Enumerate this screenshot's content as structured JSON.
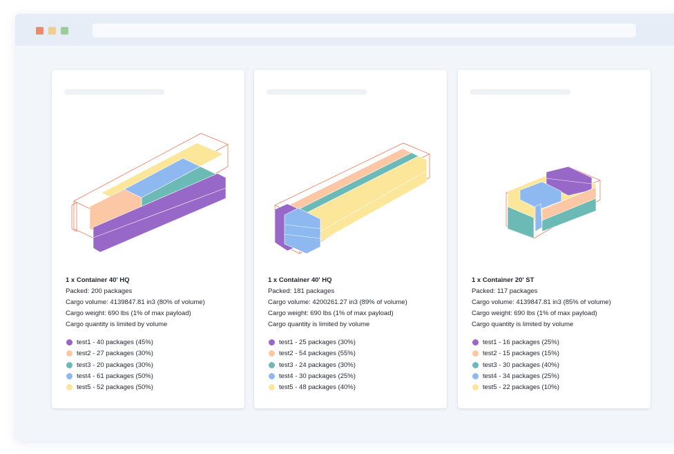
{
  "colors": {
    "test1": "#9768c7",
    "test2": "#fbc7a5",
    "test3": "#6bbab5",
    "test4": "#8eb8f0",
    "test5": "#fbe69a",
    "outline": "#e97a5c"
  },
  "window_dots": [
    "#ea8c6a",
    "#f0cf8e",
    "#9ccc9a"
  ],
  "cards": [
    {
      "title": "1 x Container 40' HQ",
      "packed": "Packed: 200 packages",
      "volume": "Cargo volume: 4139847.81 in3 (80% of volume)",
      "weight": "Cargo weight: 690 lbs (1% of max payload)",
      "limit": "Cargo quantity is limited by volume",
      "legend": [
        {
          "label": "test1 - 40 packages  (45%)",
          "color": "test1"
        },
        {
          "label": "test2 - 27 packages  (30%)",
          "color": "test2"
        },
        {
          "label": "test3 - 20 packages  (30%)",
          "color": "test3"
        },
        {
          "label": "test4 - 61 packages  (50%)",
          "color": "test4"
        },
        {
          "label": "test5 - 52 packages  (50%)",
          "color": "test5"
        }
      ]
    },
    {
      "title": "1 x Container 40' HQ",
      "packed": "Packed: 181 packages",
      "volume": "Cargo volume: 4200261.27 in3 (89% of volume)",
      "weight": "Cargo weight: 690 lbs (1% of max payload)",
      "limit": "Cargo quantity is limited by volume",
      "legend": [
        {
          "label": "test1 - 25 packages  (30%)",
          "color": "test1"
        },
        {
          "label": "test2 - 54 packages  (55%)",
          "color": "test2"
        },
        {
          "label": "test3 - 24 packages  (30%)",
          "color": "test3"
        },
        {
          "label": "test4 - 30 packages  (25%)",
          "color": "test4"
        },
        {
          "label": "test5 - 48 packages  (40%)",
          "color": "test5"
        }
      ]
    },
    {
      "title": "1 x Container 20' ST",
      "packed": "Packed: 117 packages",
      "volume": "Cargo volume: 4139847.81 in3 (85% of volume)",
      "weight": "Cargo weight: 690 lbs (1% of max payload)",
      "limit": "Cargo quantity is limited by volume",
      "legend": [
        {
          "label": "test1 - 16 packages  (25%)",
          "color": "test1"
        },
        {
          "label": "test2 - 15 packages  (15%)",
          "color": "test2"
        },
        {
          "label": "test3 - 30 packages  (40%)",
          "color": "test3"
        },
        {
          "label": "test4 - 34 packages  (25%)",
          "color": "test4"
        },
        {
          "label": "test5 - 22 packages  (10%)",
          "color": "test5"
        }
      ]
    }
  ]
}
